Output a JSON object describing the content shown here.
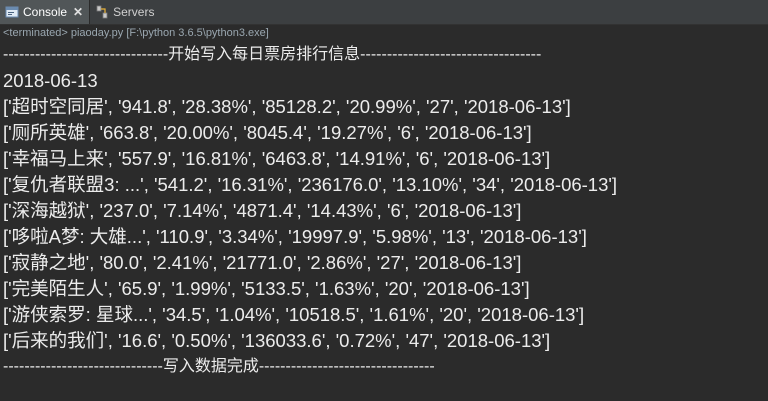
{
  "tabs": [
    {
      "label": "Console",
      "close": "✕"
    },
    {
      "label": "Servers"
    }
  ],
  "status_line": "<terminated> piaoday.py [F:\\python 3.6.5\\python3.exe]",
  "output_lines": [
    "-------------------------------开始写入每日票房排行信息----------------------------------",
    "2018-06-13",
    "['超时空同居', '941.8', '28.38%', '85128.2', '20.99%', '27', '2018-06-13']",
    "['厕所英雄', '663.8', '20.00%', '8045.4', '19.27%', '6', '2018-06-13']",
    "['幸福马上来', '557.9', '16.81%', '6463.8', '14.91%', '6', '2018-06-13']",
    "['复仇者联盟3: ...', '541.2', '16.31%', '236176.0', '13.10%', '34', '2018-06-13']",
    "['深海越狱', '237.0', '7.14%', '4871.4', '14.43%', '6', '2018-06-13']",
    "['哆啦A梦: 大雄...', '110.9', '3.34%', '19997.9', '5.98%', '13', '2018-06-13']",
    "['寂静之地', '80.0', '2.41%', '21771.0', '2.86%', '27', '2018-06-13']",
    "['完美陌生人', '65.9', '1.99%', '5133.5', '1.63%', '20', '2018-06-13']",
    "['游侠索罗: 星球...', '34.5', '1.04%', '10518.5', '1.61%', '20', '2018-06-13']",
    "['后来的我们', '16.6', '0.50%', '136033.6', '0.72%', '47', '2018-06-13']",
    "------------------------------写入数据完成---------------------------------"
  ],
  "colors": {
    "background": "#2b2b2b",
    "tabbar": "#3c3f41",
    "active_tab": "#515658",
    "text": "#ececec",
    "status_text": "#9aa7b0"
  },
  "icons": {
    "console": "console-icon",
    "servers": "servers-icon"
  }
}
